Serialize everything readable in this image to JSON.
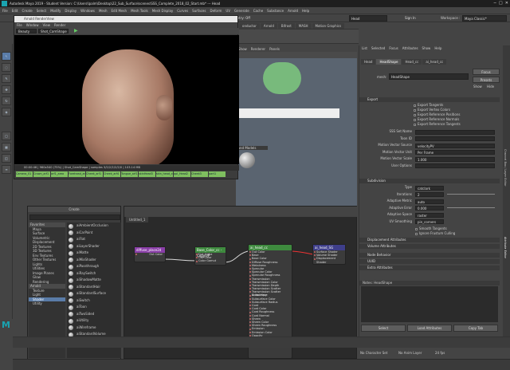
{
  "title": "Autodesk Maya 2019 - Student Version: C:\\Users\\Ipalm\\Desktop\\22_Sub_Surface\\scenes\\SSS_Complete_2018_02_Start.mb* --- Head",
  "menu": [
    "File",
    "Edit",
    "Create",
    "Select",
    "Modify",
    "Display",
    "Windows",
    "Mesh",
    "Edit Mesh",
    "Mesh Tools",
    "Mesh Display",
    "Curves",
    "Surfaces",
    "Deform",
    "UV",
    "Generate",
    "Cache",
    "Substance",
    "Arnold",
    "Help"
  ],
  "toolbar": {
    "object_field": "Head",
    "sign_in": "Sign In",
    "workspace_label": "Workspace :",
    "workspace_value": "Maya Classic*",
    "symmetry": "Symmetry: Off"
  },
  "shelf_tabs": [
    "onductor",
    "Arnold",
    "Bifrost",
    "MASH",
    "Motion Graphics",
    "XGen",
    "Custom_PolyT"
  ],
  "render_view": {
    "title": "Arnold RenderView",
    "menu": [
      "File",
      "Window",
      "View",
      "Render"
    ],
    "aov": "Beauty",
    "camera": "Shot_CamShape",
    "status": "00:00:46 | 960x540 (75%) | Shot_CamShape | samples 3/2/2/2/2/2/0 | 103.14 MB",
    "footer_buttons": [
      "Camera_01",
      "Crown_arf1",
      "arf1_area",
      "Forehead_arf1",
      "Cheek_arf1",
      "Cheek_arf4",
      "Tongue_arf1",
      "skinHead3",
      "skin_head_cc",
      "ppl_Head2",
      "Cheek3",
      "part1"
    ]
  },
  "viewport": {
    "menu": [
      "Show",
      "Renderer",
      "Panels"
    ],
    "model_label": "ound Models"
  },
  "hypershade": {
    "title": "Create",
    "tab": "Untitled_1",
    "bottom_tabs": [
      "Create",
      "Bins"
    ]
  },
  "create_lib": [
    "Favorites",
    "Maya",
    "Surface",
    "Volumetric",
    "Displacement",
    "2D Textures",
    "3D Textures",
    "Env Textures",
    "Other Textures",
    "Lights",
    "Utilities",
    "Image Planes",
    "Glow",
    "Rendering",
    "Arnold",
    "Texture",
    "Light",
    "Shader",
    "Utility"
  ],
  "shader_list": [
    "aiAmbientOcclusion",
    "aiCarPaint",
    "aiFlat",
    "aiLayerShader",
    "aiMatte",
    "aiMixShader",
    "aiPassthrough",
    "aiRaySwitch",
    "aiShadowMatte",
    "aiStandardHair",
    "aiStandardSurface",
    "aiSwitch",
    "aiToon",
    "aiTwoSided",
    "aiUtility",
    "aiWireframe",
    "aiStandardVolume"
  ],
  "nodes": {
    "file": {
      "title": "diffuse_place2d",
      "plugs": [
        "Out Color"
      ]
    },
    "cc": {
      "title": "Base_Color_cc - Copy/vP",
      "plugs": [
        "Out Alpha",
        "Out Color",
        "Color Gamut"
      ]
    },
    "ai": {
      "title": "ai_head_cc",
      "plugs": [
        "Out Color",
        "Base",
        "Base Color",
        "Diffuse Roughness",
        "Metalness",
        "Specular",
        "Specular Color",
        "Specular Roughness",
        "Transmission",
        "Transmission Color",
        "Transmission Depth",
        "Transmission Scatter",
        "Transmission Scatter Anisotropy",
        "Subsurface",
        "Subsurface Color",
        "Subsurface Radius",
        "Coat",
        "Coat Color",
        "Coat Roughness",
        "Coat Normal",
        "Sheen",
        "Sheen Color",
        "Sheen Roughness",
        "Emission",
        "Emission Color",
        "Opacity",
        "Normal Camera"
      ]
    },
    "sg": {
      "title": "ai_head_SG",
      "plugs": [
        "Surface Shader",
        "Volume Shader",
        "Displacement Shader"
      ]
    }
  },
  "attr_editor": {
    "menu": [
      "List",
      "Selected",
      "Focus",
      "Attributes",
      "Show",
      "Help"
    ],
    "tabs": [
      "Head",
      "HeadShape",
      "Head_cc",
      "ai_head_cc"
    ],
    "mesh_label": "mesh:",
    "mesh_value": "HeadShape",
    "focus": "Focus",
    "presets": "Presets",
    "show": "Show",
    "hide": "Hide",
    "export_section": "Export",
    "export_checks": [
      "Export Tangents",
      "Export Vertex Colors",
      "Export Reference Positions",
      "Export Reference Normals",
      "Export Reference Tangents"
    ],
    "fields": [
      {
        "label": "SSS Set Name",
        "value": ""
      },
      {
        "label": "Toon ID",
        "value": ""
      },
      {
        "label": "Motion Vector Source",
        "value": "velocityPV"
      },
      {
        "label": "Motion Vector Unit",
        "value": "Per Frame"
      },
      {
        "label": "Motion Vector Scale",
        "value": "1.000"
      },
      {
        "label": "User Options",
        "value": ""
      }
    ],
    "subdiv_section": "Subdivision",
    "subdiv": [
      {
        "label": "Type",
        "value": "catclark"
      },
      {
        "label": "Iterations",
        "value": "2"
      },
      {
        "label": "Adaptive Metric",
        "value": "auto"
      },
      {
        "label": "Adaptive Error",
        "value": "0.000"
      },
      {
        "label": "Adaptive Space",
        "value": "raster"
      },
      {
        "label": "UV Smoothing",
        "value": "pin_corners"
      }
    ],
    "subdiv_checks": [
      "Smooth Tangents",
      "Ignore Frustum Culling"
    ],
    "closed_sections": [
      "Displacement Attributes",
      "Volume Attributes",
      "Node Behavior",
      "UUID",
      "Extra Attributes"
    ],
    "notes_label": "Notes: HeadShape",
    "buttons": [
      "Select",
      "Load Attributes",
      "Copy Tab"
    ]
  },
  "side_tabs": [
    "Channel Box / Layer Editor",
    "Attribute Editor"
  ],
  "timeline": {
    "char_set": "No Character Set",
    "anim_layer": "No Anim Layer",
    "fps": "24 fps"
  }
}
